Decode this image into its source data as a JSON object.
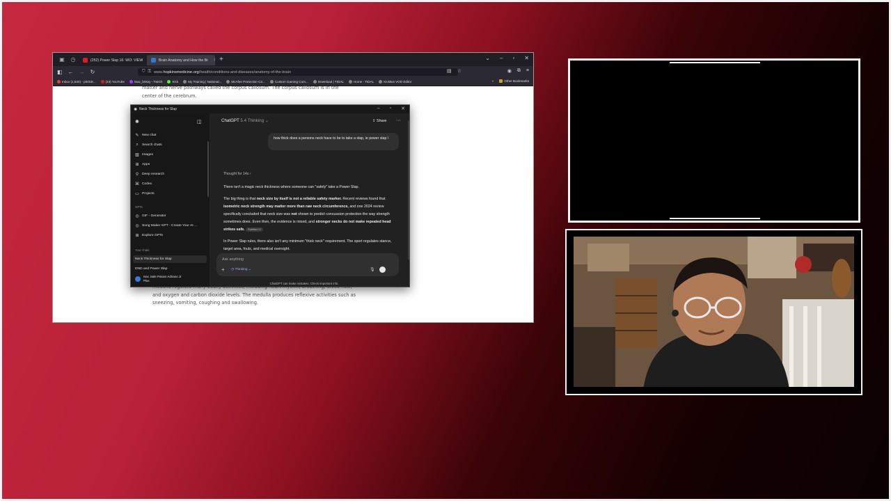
{
  "browser": {
    "tabs": [
      {
        "label": "(252) Power Slap 16: WO: VIEW",
        "active": false,
        "color": "#e01b24"
      },
      {
        "label": "Brain Anatomy and How the Br",
        "active": true,
        "color": "#2a7bd6"
      }
    ],
    "url_prefix": "www.",
    "url_domain": "hopkinsmedicine.org",
    "url_path": "/health/conditions-and-diseases/anatomy-of-the-brain",
    "bookmarks": [
      "Inbox (1,540) - p0ck3t...",
      "(23) YouTube",
      "iSac_b0ssy - Twitch",
      "Kick",
      "My Training | National...",
      "McAfee Protection Ce...",
      "Custom Gaming Com...",
      "Download | TIDAL",
      "Home - TIDAL",
      "KickBot VOD Editor"
    ],
    "bookmarks_more": "Other Bookmarks",
    "page_text_top": "matter and nerve pathways called the corpus callosum. The corpus callosum is in the center of the cerebrum.",
    "page_text_bottom": "medulla regulate many bodily activities, including heart rhythm, breathing, blood flow, and oxygen and carbon dioxide levels. The medulla produces reflexive activities such as sneezing, vomiting, coughing and swallowing."
  },
  "chatgpt": {
    "window_title": "Neck Thickness for Slap",
    "model_name": "ChatGPT",
    "model_variant": "5.4 Thinking",
    "share_label": "Share",
    "sidebar": {
      "items": [
        "New chat",
        "Search chats",
        "Images",
        "Apps",
        "Deep research",
        "Codex",
        "Projects"
      ],
      "gpts_label": "GPTs",
      "gpts": [
        "GIF - Generator",
        "Song Maker GPT - Create Your AI ...",
        "Explore GPTs"
      ],
      "chats_label": "Your chats",
      "chats": [
        "Neck Thickness for Slap",
        "DND and Power Slap"
      ],
      "user_name": "Isac Jade Pasion Adriano Jr",
      "user_plan": "Plus"
    },
    "user_message": "how thick does a persons neck have to be to take a slap, ie power slap \\",
    "thought_label": "Thought for 14s",
    "response": {
      "p1": "There isn't a magic neck thickness where someone can \"safely\" take a Power Slap.",
      "p2_a": "The big thing is that ",
      "p2_b": "neck size by itself is not a reliable safety marker.",
      "p2_c": " Recent reviews found that ",
      "p2_d": "isometric neck strength may matter more than raw neck circumference,",
      "p2_e": " and one 2024 review specifically concluded that neck size was ",
      "p2_f": "not",
      "p2_g": " shown to predict concussion protection the way strength sometimes does. Even then, the evidence is mixed, and ",
      "p2_h": "stronger necks do not make repeated head strikes safe.",
      "p2_source": "PubMed +2",
      "p3": "In Power Slap rules, there also isn't any minimum \"thick neck\" requirement. The sport regulates stance, target area, fouls, and medical oversight."
    },
    "composer_placeholder": "Ask anything",
    "composer_mode": "Thinking",
    "disclaimer": "ChatGPT can make mistakes. Check important info."
  },
  "colors": {
    "background_left": "#c5283f",
    "background_right": "#0b0101",
    "frame": "#f4f4f4"
  }
}
